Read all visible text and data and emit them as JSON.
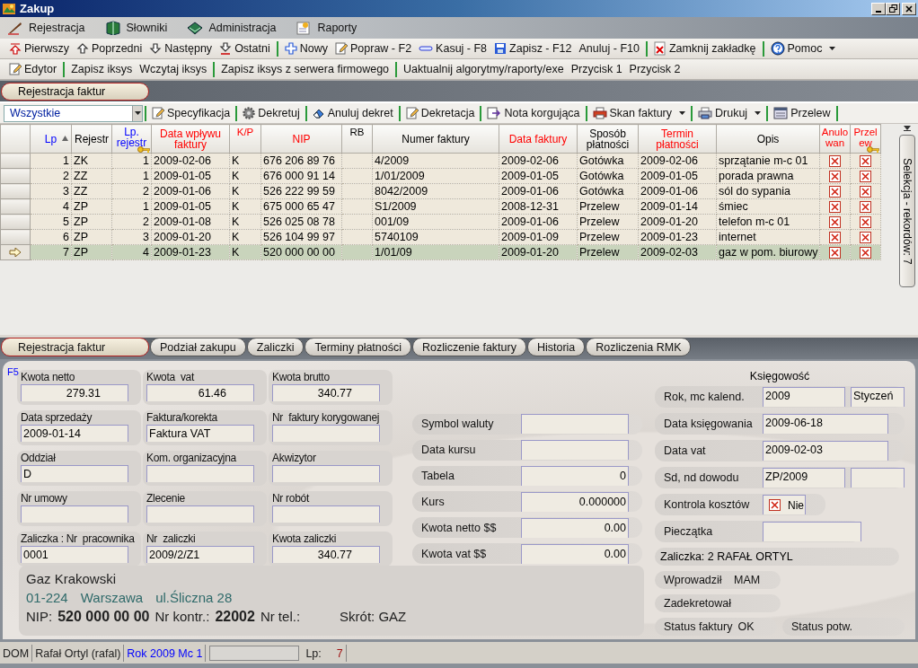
{
  "window": {
    "title": "Zakup"
  },
  "menu": [
    {
      "label": "Rejestracja"
    },
    {
      "label": "Słowniki"
    },
    {
      "label": "Administracja"
    },
    {
      "label": "Raporty"
    }
  ],
  "toolbar": [
    {
      "kind": "button",
      "label": "Pierwszy"
    },
    {
      "kind": "button",
      "label": "Poprzedni"
    },
    {
      "kind": "button",
      "label": "Następny"
    },
    {
      "kind": "button",
      "label": "Ostatni"
    },
    {
      "kind": "separator"
    },
    {
      "kind": "button",
      "label": "Nowy"
    },
    {
      "kind": "button",
      "label": "Popraw - F2"
    },
    {
      "kind": "button",
      "label": "Kasuj - F8"
    },
    {
      "kind": "button",
      "label": "Zapisz - F12"
    },
    {
      "kind": "text",
      "label": "Anuluj - F10"
    },
    {
      "kind": "separator"
    },
    {
      "kind": "button",
      "label": "Zamknij zakładkę"
    },
    {
      "kind": "separator"
    },
    {
      "kind": "dropdown",
      "label": "Pomoc"
    }
  ],
  "toolbar_2": [
    {
      "kind": "button",
      "label": "Edytor"
    },
    {
      "kind": "separator"
    },
    {
      "kind": "text",
      "label": "Zapisz iksys"
    },
    {
      "kind": "text",
      "label": "Wczytaj iksys"
    },
    {
      "kind": "separator"
    },
    {
      "kind": "text",
      "label": "Zapisz iksys z serwera firmowego"
    },
    {
      "kind": "separator"
    },
    {
      "kind": "text",
      "label": "Uaktualnij algorytmy/raporty/exe"
    },
    {
      "kind": "text",
      "label": "Przycisk 1"
    },
    {
      "kind": "text",
      "label": "Przycisk 2"
    }
  ],
  "doc_tabs": [
    {
      "label": "Rejestracja faktur",
      "selected": true
    }
  ],
  "grid_toolbar": {
    "filter": {
      "value": "Wszystkie"
    },
    "items": [
      {
        "kind": "separator"
      },
      {
        "kind": "button",
        "label": "Specyfikacja"
      },
      {
        "kind": "separator"
      },
      {
        "kind": "button",
        "label": "Dekretuj"
      },
      {
        "kind": "separator"
      },
      {
        "kind": "button",
        "label": "Anuluj dekret"
      },
      {
        "kind": "separator"
      },
      {
        "kind": "button",
        "label": "Dekretacja"
      },
      {
        "kind": "separator"
      },
      {
        "kind": "button",
        "label": "Nota korgująca"
      },
      {
        "kind": "separator"
      },
      {
        "kind": "dropdown",
        "label": "Skan faktury"
      },
      {
        "kind": "separator"
      },
      {
        "kind": "dropdown",
        "label": "Drukuj"
      },
      {
        "kind": "separator"
      },
      {
        "kind": "button",
        "label": "Przelew"
      },
      {
        "kind": "separator"
      }
    ]
  },
  "table": {
    "columns": [
      {
        "label": "Lp",
        "color": "#0000ff",
        "sorted": true,
        "key": false
      },
      {
        "label": "Rejestr",
        "color": "#000000",
        "sorted": false,
        "key": false
      },
      {
        "label": "Lp. rejestr",
        "color": "#0000ff",
        "sorted": false,
        "key": true
      },
      {
        "label": "Data wpływu faktury",
        "color": "#ff0000",
        "sorted": false,
        "key": false
      },
      {
        "label": "K/P",
        "color": "#ff0000",
        "sorted": false,
        "key": false
      },
      {
        "label": "NIP",
        "color": "#ff0000",
        "sorted": false,
        "key": false
      },
      {
        "label": "RB",
        "color": "#000000",
        "sorted": false,
        "key": false
      },
      {
        "label": "Numer faktury",
        "color": "#000000",
        "sorted": false,
        "key": false
      },
      {
        "label": "Data faktury",
        "color": "#ff0000",
        "sorted": false,
        "key": false
      },
      {
        "label": "Sposób płatności",
        "color": "#000000",
        "sorted": false,
        "key": false
      },
      {
        "label": "Termin płatności",
        "color": "#ff0000",
        "sorted": false,
        "key": false
      },
      {
        "label": "Opis",
        "color": "#000000",
        "sorted": false,
        "key": false
      },
      {
        "label": "Anulowan",
        "color": "#ff0000",
        "sorted": false,
        "key": false
      },
      {
        "label": "Przelew",
        "color": "#ff0000",
        "sorted": false,
        "key": true
      }
    ],
    "rows": [
      {
        "selected": false,
        "cells": [
          "1",
          "ZK",
          "1",
          "2009-02-06",
          "K",
          "676 206 89 76",
          null,
          "4/2009",
          "2009-02-06",
          "Gotówka",
          "2009-02-06",
          "sprzątanie m-c 01"
        ],
        "cancelled": false,
        "transfer": false
      },
      {
        "selected": false,
        "cells": [
          "2",
          "ZZ",
          "1",
          "2009-01-05",
          "K",
          "676 000 91 14",
          null,
          "1/01/2009",
          "2009-01-05",
          "Gotówka",
          "2009-01-05",
          "porada prawna"
        ],
        "cancelled": false,
        "transfer": false
      },
      {
        "selected": false,
        "cells": [
          "3",
          "ZZ",
          "2",
          "2009-01-06",
          "K",
          "526 222 99 59",
          null,
          "8042/2009",
          "2009-01-06",
          "Gotówka",
          "2009-01-06",
          "sól do sypania"
        ],
        "cancelled": false,
        "transfer": false
      },
      {
        "selected": false,
        "cells": [
          "4",
          "ZP",
          "1",
          "2009-01-05",
          "K",
          "675 000 65 47",
          null,
          "S1/2009",
          "2008-12-31",
          "Przelew",
          "2009-01-14",
          "śmiec"
        ],
        "cancelled": false,
        "transfer": false
      },
      {
        "selected": false,
        "cells": [
          "5",
          "ZP",
          "2",
          "2009-01-08",
          "K",
          "526 025 08 78",
          null,
          "001/09",
          "2009-01-06",
          "Przelew",
          "2009-01-20",
          "telefon m-c 01"
        ],
        "cancelled": false,
        "transfer": false
      },
      {
        "selected": false,
        "cells": [
          "6",
          "ZP",
          "3",
          "2009-01-20",
          "K",
          "526 104 99 97",
          null,
          "5740109",
          "2009-01-09",
          "Przelew",
          "2009-01-23",
          "internet"
        ],
        "cancelled": false,
        "transfer": false
      },
      {
        "selected": true,
        "cells": [
          "7",
          "ZP",
          "4",
          "2009-01-23",
          "K",
          "520 000 00 00",
          null,
          "1/01/09",
          "2009-01-20",
          "Przelew",
          "2009-02-03",
          "gaz w pom. biurowy"
        ],
        "cancelled": false,
        "transfer": false
      }
    ]
  },
  "side_tab": {
    "label": "Selekcja - rekordów: 7"
  },
  "detail_tabs": [
    {
      "label": "Rejestracja faktur",
      "selected": true
    },
    {
      "label": "Podział zakupu",
      "selected": false
    },
    {
      "label": "Zaliczki",
      "selected": false
    },
    {
      "label": "Terminy płatności",
      "selected": false
    },
    {
      "label": "Rozliczenie faktury",
      "selected": false
    },
    {
      "label": "Historia",
      "selected": false
    },
    {
      "label": "Rozliczenia RMK",
      "selected": false
    }
  ],
  "form": {
    "hint": "F5",
    "fields": [
      {
        "label": "Kwota netto",
        "value": "279.31",
        "kind": "number"
      },
      {
        "label": "Kwota  vat",
        "value": "61.46",
        "kind": "number"
      },
      {
        "label": "Kwota brutto",
        "value": "340.77",
        "kind": "number"
      },
      {
        "label": "Data sprzedaży",
        "value": "2009-01-14",
        "kind": "text"
      },
      {
        "label": "Faktura/korekta",
        "value": "Faktura VAT",
        "kind": "text"
      },
      {
        "label": "Nr  faktury korygowanej",
        "kind": "text"
      },
      {
        "label": "Oddział",
        "value": "D",
        "kind": "text"
      },
      {
        "label": "Kom. organizacyjna",
        "kind": "text"
      },
      {
        "label": "Akwizytor",
        "kind": "text"
      },
      {
        "label": "Nr umowy",
        "kind": "text"
      },
      {
        "label": "Zlecenie",
        "kind": "text"
      },
      {
        "label": "Nr robót",
        "kind": "text"
      },
      {
        "label": "Zaliczka : Nr  pracownika",
        "value": "0001",
        "kind": "text"
      },
      {
        "label": "Nr  zaliczki",
        "value": "2009/2/Z1",
        "kind": "text"
      },
      {
        "label": "Kwota zaliczki",
        "value": "340.77",
        "kind": "number"
      }
    ],
    "contractor": {
      "name": "Gaz Krakowski",
      "postal_code": "01-224",
      "city": "Warszawa",
      "street": "ul.Śliczna 28",
      "nip_label": "NIP:",
      "nip": "520 000 00 00",
      "number_label": "Nr kontr.:",
      "number": "22002",
      "phone_label": "Nr tel.:",
      "short_name": "Skrót: GAZ"
    },
    "currency": [
      {
        "label": "Symbol waluty"
      },
      {
        "label": "Data kursu"
      },
      {
        "label": "Tabela",
        "value": "0"
      },
      {
        "label": "Kurs",
        "value": "0.000000"
      },
      {
        "label": "Kwota netto $$",
        "value": "0.00"
      },
      {
        "label": "Kwota vat $$",
        "value": "0.00"
      }
    ],
    "accounting": {
      "title": "Księgowość",
      "rows": [
        {
          "kind": "fields",
          "label": "Rok, mc  kalend.",
          "values": [
            "2009",
            "Styczeń"
          ]
        },
        {
          "kind": "fields",
          "label": "Data księgowania",
          "values": [
            "2009-06-18"
          ]
        },
        {
          "kind": "fields",
          "label": "Data vat",
          "values": [
            "2009-02-03"
          ]
        },
        {
          "kind": "fields",
          "label": "Sd, nd dowodu",
          "values": [
            "ZP/2009"
          ],
          "blank_field": true
        },
        {
          "kind": "checkbox",
          "label": "Kontrola kosztów",
          "checked": false,
          "value": "Nie"
        },
        {
          "kind": "fields",
          "label": "Pieczątka",
          "blank_field": true
        },
        {
          "kind": "info",
          "label": "Zaliczka: 2 RAFAŁ ORTYL"
        },
        {
          "kind": "pair",
          "items": [
            {
              "label": "Wprowadził",
              "value": "MAM"
            }
          ]
        },
        {
          "kind": "pair",
          "items": [
            {
              "label": "Zadekretował"
            }
          ]
        },
        {
          "kind": "pair",
          "items": [
            {
              "label": "Status faktury",
              "value": "OK"
            },
            {
              "label": "Status potw."
            }
          ]
        }
      ]
    }
  },
  "status_bar": [
    {
      "text": "DOM",
      "color": "#202020"
    },
    {
      "text": "Rafał Ortyl (rafal)",
      "color": "#202020"
    },
    {
      "text": "Rok 2009  Mc 1",
      "color": "#0000ff"
    },
    {
      "kind": "field"
    },
    {
      "text": "Lp:",
      "color": "#202020"
    },
    {
      "text": "7",
      "color": "#a01010"
    }
  ]
}
